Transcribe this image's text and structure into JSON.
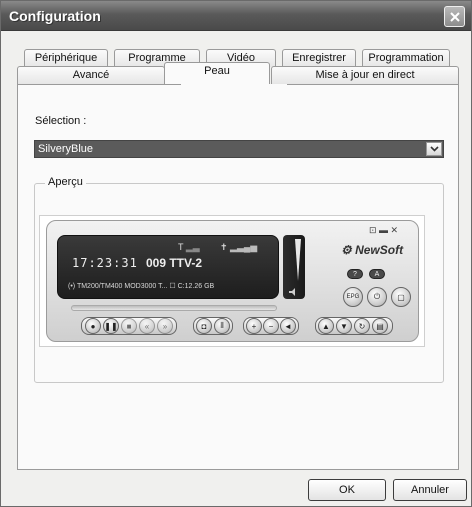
{
  "window": {
    "title": "Configuration"
  },
  "tabs_row1": [
    "Périphérique",
    "Programme",
    "Vidéo",
    "Enregistrer",
    "Programmation"
  ],
  "tabs_row2": [
    "Avancé",
    "Peau",
    "Mise à jour en direct"
  ],
  "active_tab": "Peau",
  "skin": {
    "selection_label": "Sélection :",
    "selection_value": "SilveryBlue",
    "preview_label": "Aperçu"
  },
  "player": {
    "time": "17:23:31",
    "channel": "009 TTV-2",
    "device": "TM200/TM400 MOD3000 T... ☐ C:12.26 GB",
    "brand": "NewSoft",
    "window_controls": "⊡ ▬ ✕",
    "side_buttons": [
      "EPG",
      "⏻",
      "▢"
    ],
    "small_buttons": [
      "?",
      "A"
    ]
  },
  "buttons": {
    "ok": "OK",
    "cancel": "Annuler"
  }
}
